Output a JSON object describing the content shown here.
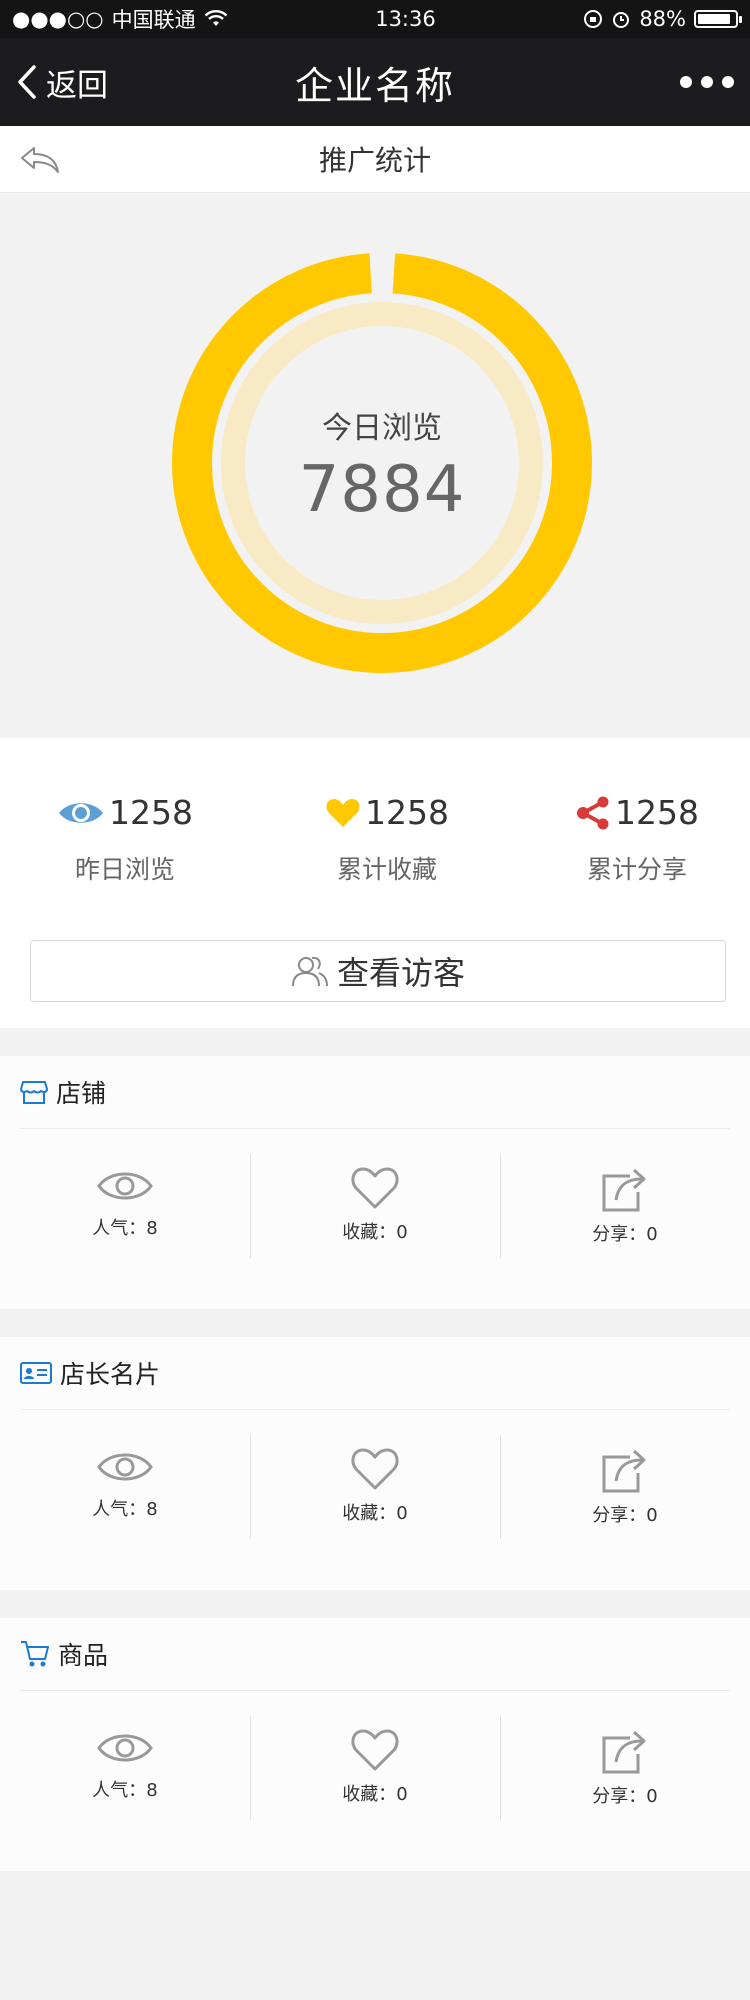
{
  "status": {
    "signal": "●●●○○",
    "carrier": "中国联通",
    "time": "13:36",
    "battery": "88%"
  },
  "nav": {
    "back_label": "返回",
    "title": "企业名称"
  },
  "sub": {
    "title": "推广统计"
  },
  "hero": {
    "label": "今日浏览",
    "value": "7884",
    "ring_fraction": 0.98,
    "ring_color": "#ffc800",
    "track_color": "#f7eac4"
  },
  "stats": [
    {
      "value": "1258",
      "label": "昨日浏览",
      "icon": "eye-icon",
      "color": "#5c9fd6"
    },
    {
      "value": "1258",
      "label": "累计收藏",
      "icon": "heart-icon",
      "color": "#ffc800"
    },
    {
      "value": "1258",
      "label": "累计分享",
      "icon": "share-icon",
      "color": "#d83a3a"
    }
  ],
  "visitor_button": {
    "label": "查看访客"
  },
  "sections": [
    {
      "title": "店铺",
      "icon": "store-icon",
      "popularity": "人气：8",
      "favorites": "收藏：0",
      "shares": "分享：0"
    },
    {
      "title": "店长名片",
      "icon": "id-card-icon",
      "popularity": "人气：8",
      "favorites": "收藏：0",
      "shares": "分享：0"
    },
    {
      "title": "商品",
      "icon": "cart-icon",
      "popularity": "人气：8",
      "favorites": "收藏：0",
      "shares": "分享：0"
    }
  ],
  "accent": "#1a7bd6"
}
